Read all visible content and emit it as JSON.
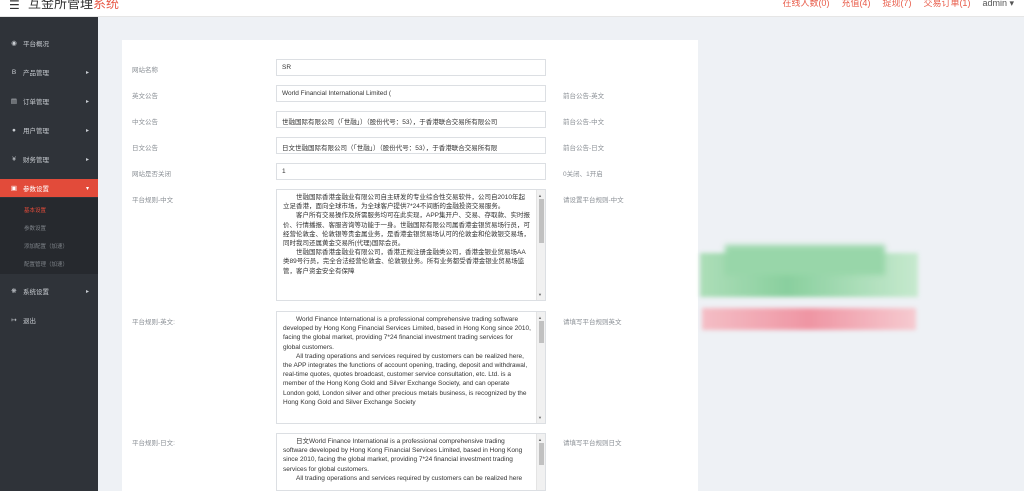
{
  "header": {
    "brand": "互金所管理",
    "brand_suffix": "系统",
    "links": [
      "在线人数(0)",
      "充值(4)",
      "提现(7)",
      "交易订单(1)"
    ],
    "user": "admin",
    "menu_icon": "hamburger-icon"
  },
  "sidebar": {
    "items": [
      {
        "label": "平台概况",
        "icon": "dashboard-icon"
      },
      {
        "label": "产品管理",
        "icon": "bitcoin-icon"
      },
      {
        "label": "订单管理",
        "icon": "clipboard-icon"
      },
      {
        "label": "用户管理",
        "icon": "user-icon"
      },
      {
        "label": "财务管理",
        "icon": "yen-icon"
      },
      {
        "label": "参数设置",
        "icon": "settings-icon"
      },
      {
        "label": "系统设置",
        "icon": "gears-icon"
      },
      {
        "label": "退出",
        "icon": "logout-icon"
      }
    ],
    "sub_items": [
      "基本设置",
      "参数设置",
      "添加配置（加速）",
      "配置管理（加速）"
    ],
    "active_color": "#e24b3a"
  },
  "form": {
    "site_name": {
      "label": "网站名称",
      "value": "SR"
    },
    "en_notice": {
      "label": "英文公告",
      "value": "World Financial International Limited (",
      "hint": "前台公告-英文"
    },
    "cn_notice": {
      "label": "中文公告",
      "value": "世融国际有限公司（「世融」）（股份代号：53），于香港联合交易所有限公司",
      "hint": "前台公告-中文"
    },
    "jp_notice": {
      "label": "日文公告",
      "value": "日文世融国际有限公司（「世融」）（股份代号：53），于香港联合交易所有限",
      "hint": "前台公告-日文"
    },
    "site_closed": {
      "label": "网站是否关闭",
      "value": "1",
      "hint": "0关闭、1开启"
    },
    "rules_cn": {
      "label": "平台规则-中文",
      "hint": "请设置平台规则-中文",
      "paragraphs": [
        "世融国际香港金融业有限公司自主研发的专业综合性交易软件，公司自2010年起立足香港，面向全球市场，为全球客户提供7*24不间断的金融投资交易服务。",
        "客户所有交易操作及所需服务均可在此实现，APP集开户、交易、存取款、实时报价、行情播报、客服咨询等功能于一身。世融国际有限公司属香港金银贸易场行员，可经营伦敦金、伦敦银等贵金属业务，是香港金银贸易场认可的伦敦金和伦敦银交易场，同时我司还属黄金交易所(代理)国际会员。",
        "世融国际香港金融业有限公司，香港正规注册金融类公司，香港金银业贸易场AA类89号行员，完全合法经营伦敦金、伦敦银业务。所有业务都受香港金银业贸易场监管，客户资金安全有保障"
      ]
    },
    "rules_en": {
      "label": "平台规则-英文:",
      "hint": "请填写平台规则英文",
      "paragraphs": [
        "World Finance International is a professional comprehensive trading software developed by Hong Kong Financial Services Limited, based in Hong Kong since 2010, facing the global market, providing 7*24 financial investment trading services for global customers.",
        "All trading operations and services required by customers can be realized here, the APP integrates the functions of account opening, trading, deposit and withdrawal, real-time quotes, quotes broadcast, customer service consultation, etc. Ltd. is a member of the Hong Kong Gold and Silver Exchange Society, and can operate London gold, London silver and other precious metals business, is recognized by the Hong Kong Gold and Silver Exchange Society"
      ]
    },
    "rules_jp": {
      "label": "平台规则-日文:",
      "hint": "请填写平台规则日文",
      "paragraphs": [
        "日文World Finance International is a professional comprehensive trading software developed by Hong Kong Financial Services Limited, based in Hong Kong since 2010, facing the global market, providing 7*24 financial investment trading services for global customers.",
        "All trading operations and services required by customers can be realized here"
      ]
    }
  }
}
